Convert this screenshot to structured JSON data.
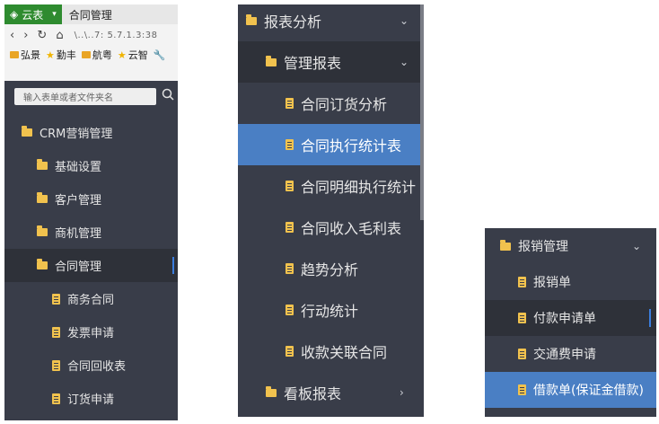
{
  "browser": {
    "tab_app": "云表",
    "tab_title": "合同管理",
    "address": "\\..\\..7: 5.7.1.3:38",
    "bookmarks": [
      "弘景",
      "勤丰",
      "航粤",
      "云智"
    ]
  },
  "search": {
    "placeholder": "输入表单或者文件夹名"
  },
  "panel1": {
    "root": "CRM营销管理",
    "folders": [
      "基础设置",
      "客户管理",
      "商机管理",
      "合同管理"
    ],
    "docs": [
      "商务合同",
      "发票申请",
      "合同回收表",
      "订货申请"
    ]
  },
  "panel2": {
    "top": "报表分析",
    "sub": "管理报表",
    "items": [
      "合同订货分析",
      "合同执行统计表",
      "合同明细执行统计",
      "合同收入毛利表",
      "趋势分析",
      "行动统计",
      "收款关联合同"
    ],
    "bottom": "看板报表"
  },
  "panel3": {
    "folder": "报销管理",
    "items": [
      "报销单",
      "付款申请单",
      "交通费申请",
      "借款单(保证金借款)"
    ]
  },
  "colors": {
    "sidebar_bg": "#393d49",
    "active_blue": "#4a7fc4",
    "active_dark": "#2e3139",
    "icon_yellow": "#f1c24e",
    "browser_green": "#2e8b2f"
  }
}
